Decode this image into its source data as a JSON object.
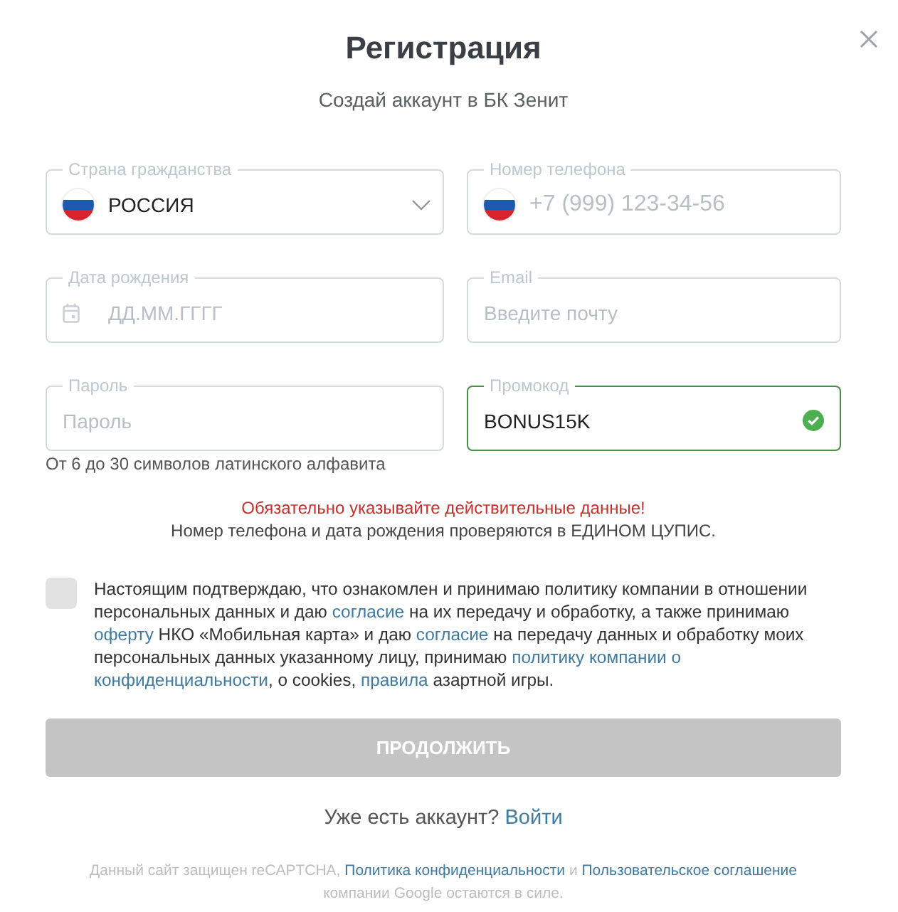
{
  "window": {
    "title": "Регистрация",
    "subtitle": "Создай аккаунт в БК Зенит"
  },
  "fields": [
    {
      "kind": "select",
      "label": "Страна гражданства",
      "value": "РОССИЯ",
      "valid": false
    },
    {
      "kind": "phone",
      "label": "Номер телефона",
      "placeholder": "+7 (999) 123-34-56",
      "valid": false
    },
    {
      "kind": "date",
      "label": "Дата рождения",
      "placeholder": "ДД.ММ.ГГГГ",
      "valid": false
    },
    {
      "kind": "text",
      "label": "Email",
      "placeholder": "Введите почту",
      "valid": false
    },
    {
      "kind": "text",
      "label": "Пароль",
      "placeholder": "Пароль",
      "hint": "От 6 до 30 символов латинского алфавита",
      "valid": false
    },
    {
      "kind": "text",
      "label": "Промокод",
      "value": "BONUS15K",
      "valid": true
    }
  ],
  "notice": {
    "warning": "Обязательно указывайте действительные данные!",
    "text": "Номер телефона и дата рождения проверяются в ЕДИНОМ ЦУПИС."
  },
  "consent": {
    "checked": false,
    "segments": [
      {
        "kind": "text",
        "text": "Настоящим подтверждаю, что ознакомлен и принимаю политику компании в отношении персональных данных и даю "
      },
      {
        "kind": "link",
        "text": "согласие"
      },
      {
        "kind": "text",
        "text": " на их передачу и обработку, а также принимаю "
      },
      {
        "kind": "link",
        "text": "оферту"
      },
      {
        "kind": "text",
        "text": " НКО «Мобильная карта» и даю "
      },
      {
        "kind": "link",
        "text": "согласие"
      },
      {
        "kind": "text",
        "text": " на передачу данных и обработку моих персональных данных указанному лицу, принимаю "
      },
      {
        "kind": "link",
        "text": "политику компании о"
      },
      {
        "kind": "link",
        "text": "конфиденциальности"
      },
      {
        "kind": "text",
        "text": ", о cookies, "
      },
      {
        "kind": "link",
        "text": "правила"
      },
      {
        "kind": "text",
        "text": " азартной игры."
      }
    ]
  },
  "submit": {
    "label": "ПРОДОЛЖИТЬ",
    "disabled": true
  },
  "login": {
    "prompt": "Уже есть аккаунт?",
    "link": "Войти"
  },
  "footer": {
    "segments": [
      {
        "kind": "text",
        "text": "Данный сайт защищен reCAPTCHA, "
      },
      {
        "kind": "link",
        "text": "Политика конфиденциальности"
      },
      {
        "kind": "text",
        "text": " и "
      },
      {
        "kind": "link",
        "text": "Пользовательское соглашение"
      },
      {
        "kind": "text",
        "text": " компании Google остаются в силе."
      }
    ]
  }
}
